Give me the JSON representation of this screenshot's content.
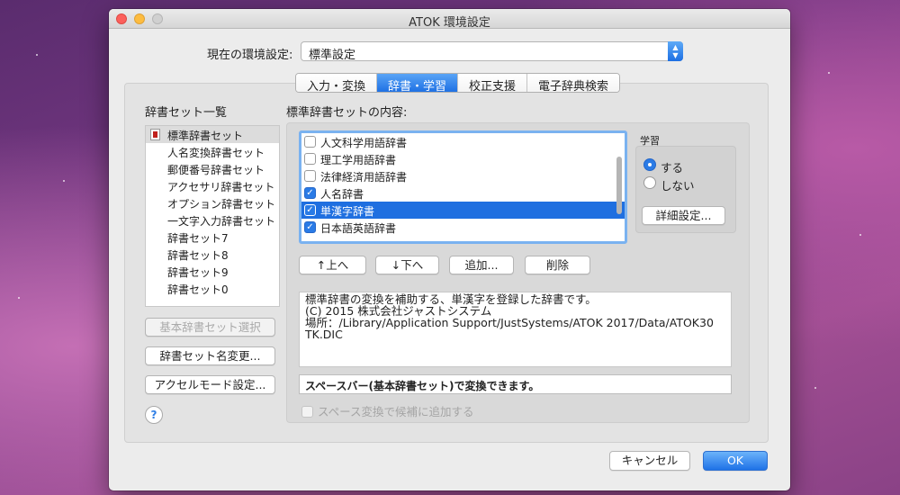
{
  "window": {
    "title": "ATOK 環境設定"
  },
  "current_env": {
    "label": "現在の環境設定:",
    "value": "標準設定"
  },
  "tabs": [
    {
      "label": "入力・変換",
      "active": false
    },
    {
      "label": "辞書・学習",
      "active": true
    },
    {
      "label": "校正支援",
      "active": false
    },
    {
      "label": "電子辞典検索",
      "active": false
    }
  ],
  "dict_sets": {
    "heading": "辞書セット一覧",
    "items": [
      {
        "label": "標準辞書セット",
        "selected": true,
        "icon": "atok-dictionary-icon"
      },
      {
        "label": "人名変換辞書セット"
      },
      {
        "label": "郵便番号辞書セット"
      },
      {
        "label": "アクセサリ辞書セット"
      },
      {
        "label": "オプション辞書セット"
      },
      {
        "label": "一文字入力辞書セット"
      },
      {
        "label": "辞書セット7"
      },
      {
        "label": "辞書セット8"
      },
      {
        "label": "辞書セット9"
      },
      {
        "label": "辞書セット0"
      }
    ],
    "buttons": {
      "basic_select": "基本辞書セット選択",
      "rename": "辞書セット名変更...",
      "accel": "アクセルモード設定..."
    },
    "help": "?"
  },
  "contents": {
    "heading": "標準辞書セットの内容:",
    "items": [
      {
        "label": "人文科学用語辞書",
        "checked": false
      },
      {
        "label": "理工学用語辞書",
        "checked": false
      },
      {
        "label": "法律経済用語辞書",
        "checked": false
      },
      {
        "label": "人名辞書",
        "checked": true
      },
      {
        "label": "単漢字辞書",
        "checked": true,
        "selected": true
      },
      {
        "label": "日本語英語辞書",
        "checked": true
      }
    ],
    "check_mark": "✓",
    "buttons": {
      "up": "↑上へ",
      "down": "↓下へ",
      "add": "追加...",
      "delete": "削除"
    },
    "description": [
      "標準辞書の変換を補助する、単漢字を登録した辞書です。",
      "(C) 2015 株式会社ジャストシステム",
      "場所：/Library/Application Support/JustSystems/ATOK 2017/Data/ATOK30",
      "TK.DIC"
    ],
    "status": "スペースバー(基本辞書セット)で変換できます。",
    "space_option": "スペース変換で候補に追加する"
  },
  "learning": {
    "heading": "学習",
    "options": [
      {
        "label": "する",
        "selected": true
      },
      {
        "label": "しない",
        "selected": false
      }
    ],
    "detail_button": "詳細設定..."
  },
  "footer": {
    "cancel": "キャンセル",
    "ok": "OK"
  },
  "colors": {
    "accent": "#1f6fe0",
    "window_bg": "#ececec"
  }
}
